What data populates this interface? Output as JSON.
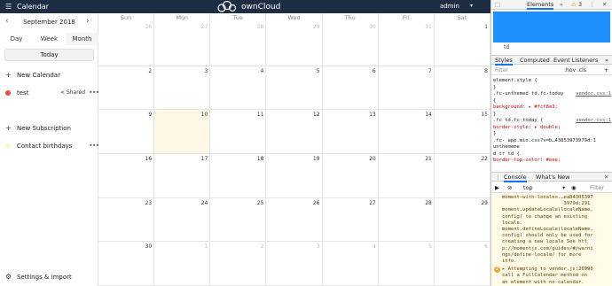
{
  "topbar": {
    "app_title": "Calendar",
    "brand": "ownCloud",
    "user": "admin"
  },
  "sidebar": {
    "month_label": "September 2018",
    "views": [
      "Day",
      "Week",
      "Month"
    ],
    "today_label": "Today",
    "new_calendar": "New Calendar",
    "calendar_name": "test",
    "calendar_color": "#e74c3c",
    "shared_label": "Shared",
    "new_subscription": "New Subscription",
    "contact_birthdays": "Contact birthdays",
    "birthday_color": "#fcf8b0",
    "settings_label": "Settings & import"
  },
  "calendar": {
    "day_names": [
      "Sun",
      "Mon",
      "Tue",
      "Wed",
      "Thu",
      "Fri",
      "Sat"
    ],
    "weeks": [
      [
        "26",
        "27",
        "28",
        "29",
        "30",
        "31",
        "1"
      ],
      [
        "2",
        "3",
        "4",
        "5",
        "6",
        "7",
        "8"
      ],
      [
        "9",
        "10",
        "11",
        "12",
        "13",
        "14",
        "15"
      ],
      [
        "16",
        "17",
        "18",
        "19",
        "20",
        "21",
        "22"
      ],
      [
        "23",
        "24",
        "25",
        "26",
        "27",
        "28",
        "29"
      ],
      [
        "30",
        "1",
        "2",
        "3",
        "4",
        "5",
        "6"
      ]
    ],
    "today_color": "#fcf8e3"
  },
  "devtools": {
    "tab_elements": "Elements",
    "warn_count": "3",
    "breadcrumb": "td",
    "tab_styles": "Styles",
    "tab_computed": "Computed",
    "tab_event_listeners": "Event Listeners",
    "filter_placeholder": "Filter",
    "hov_cls": ":hov .cls",
    "rules": [
      {
        "sel": "element.style {",
        "src": ""
      },
      {
        "sel": "}",
        "src": ""
      },
      {
        "sel": ".fc-unthemed td.fc-today",
        "src": "vendor.css:1"
      },
      {
        "sel": "{",
        "src": ""
      },
      {
        "sel": "  background: ▸ #fcf8e3;",
        "src": ""
      },
      {
        "sel": "}",
        "src": ""
      },
      {
        "sel": ".fc td.fc-today {",
        "src": "vendor.css:1"
      },
      {
        "sel": "  border-style: ▸ double;",
        "src": ""
      },
      {
        "sel": "}",
        "src": ""
      },
      {
        "sel": ".fc-    app.min.css?v=b…43853973979d:1",
        "src": ""
      },
      {
        "sel": "unthememe",
        "src": ""
      },
      {
        "sel": "d tr td {",
        "src": ""
      },
      {
        "sel": "  border-top-color: #eee;",
        "src": ""
      }
    ],
    "console_tab": "Console",
    "whats_new_tab": "What's New",
    "context": "top",
    "console_filter": "Filter",
    "console_lines": [
      "moment-with-locales.…ea84305397",
      "                     3979d:291",
      "moment.updateLocale(localeName,",
      "config) to change an existing",
      "locale.",
      "moment.defineLocale(localeName,",
      "config) should only be used for",
      "creating a new locale See htt",
      "p://momentjs.com/guides/#/warni",
      "ngs/define-locale/ for more",
      "info."
    ],
    "warn_count_2": "2",
    "console_warn": [
      "▸ Attempting to vendor.js:26990",
      "call a FullCalendar method on",
      "an element with no calendar."
    ]
  }
}
